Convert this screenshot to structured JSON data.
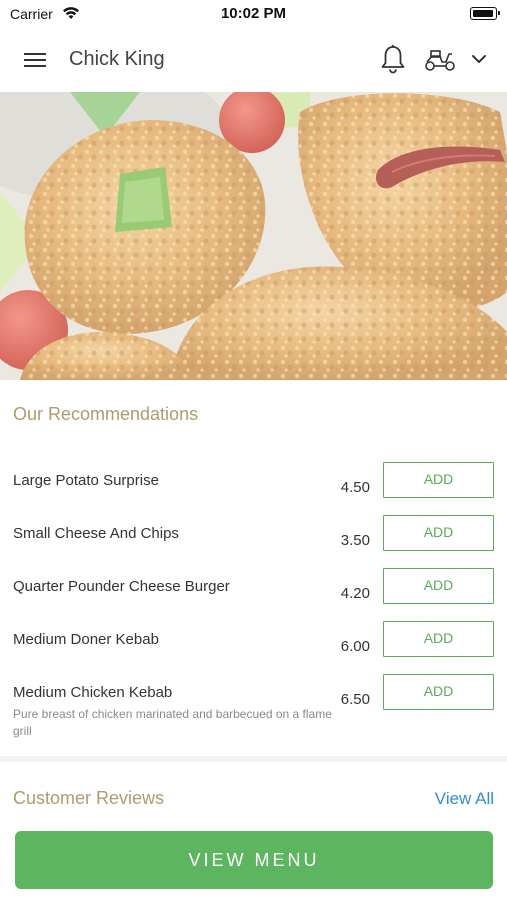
{
  "status_bar": {
    "carrier": "Carrier",
    "time": "10:02 PM"
  },
  "header": {
    "title": "Chick King"
  },
  "hero": {
    "alt": "fried chicken"
  },
  "recommendations": {
    "title": "Our Recommendations",
    "add_label": "ADD",
    "items": [
      {
        "name": "Large Potato Surprise",
        "price": "4.50",
        "description": ""
      },
      {
        "name": "Small Cheese And Chips",
        "price": "3.50",
        "description": ""
      },
      {
        "name": "Quarter Pounder Cheese Burger",
        "price": "4.20",
        "description": ""
      },
      {
        "name": "Medium Doner Kebab",
        "price": "6.00",
        "description": ""
      },
      {
        "name": "Medium Chicken Kebab",
        "price": "6.50",
        "description": "Pure breast of chicken marinated and barbecued on a flame grill"
      }
    ]
  },
  "reviews": {
    "title": "Customer Reviews",
    "view_all": "View All"
  },
  "footer": {
    "view_menu": "VIEW MENU"
  },
  "colors": {
    "accent_green": "#5aab5c",
    "gold_heading": "#b19b6e",
    "link_blue": "#2f8fd0"
  },
  "icons": [
    "wifi-icon",
    "battery-icon",
    "hamburger-menu-icon",
    "bell-icon",
    "scooter-icon",
    "chevron-down-icon"
  ]
}
